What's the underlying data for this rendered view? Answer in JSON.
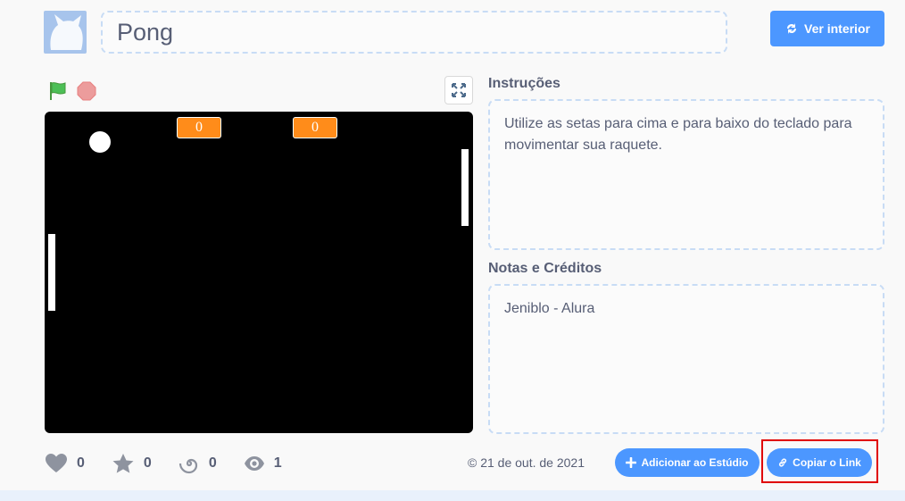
{
  "project": {
    "title": "Pong",
    "see_inside_label": "Ver interior"
  },
  "stage": {
    "score_left": "0",
    "score_right": "0"
  },
  "instructions": {
    "heading": "Instruções",
    "text": "Utilize as setas para cima e para baixo do teclado para movimentar sua raquete."
  },
  "notes": {
    "heading": "Notas e Créditos",
    "text": "Jeniblo - Alura"
  },
  "stats": {
    "loves": "0",
    "favorites": "0",
    "remixes": "0",
    "views": "1"
  },
  "date": "© 21 de out. de 2021",
  "actions": {
    "add_to_studio": "Adicionar ao Estúdio",
    "copy_link": "Copiar o Link"
  },
  "icons": {
    "avatar": "cat-avatar-icon",
    "see_inside": "remix-arrows-icon",
    "flag": "green-flag-icon",
    "stop": "stop-icon",
    "fullscreen": "fullscreen-icon",
    "loves": "heart-icon",
    "favorites": "star-icon",
    "remixes": "remix-spiral-icon",
    "views": "eye-icon",
    "add_to_studio": "plus-icon",
    "copy_link": "link-icon"
  },
  "colors": {
    "accent": "#4c97ff",
    "score_bg": "#ff8c1a",
    "highlight_border": "#e00000",
    "flag_green": "#4cbf56",
    "stop_red": "#ec9c9c"
  }
}
